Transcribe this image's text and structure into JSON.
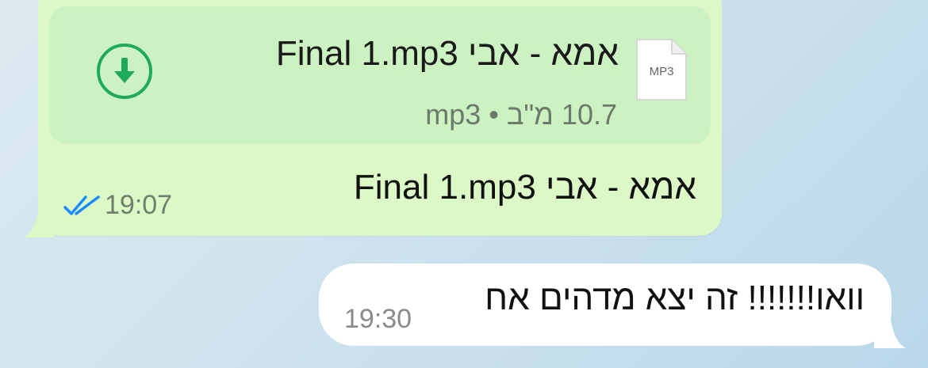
{
  "outgoing": {
    "file": {
      "name": "אמא - אבי  Final 1.mp3",
      "meta": "10.7 מ\"ב • mp3",
      "icon_label": "MP3",
      "icon": "download-icon"
    },
    "caption": "אמא - אבי  Final 1.mp3",
    "time": "19:07",
    "status_icon": "double-check-icon",
    "colors": {
      "bubble": "#dcf8c6",
      "card": "#cdf2c2",
      "accent": "#1faa59",
      "ticks": "#1a8cff"
    }
  },
  "incoming": {
    "text": "וואו!!!!!!! זה יצא מדהים אח",
    "time": "19:30",
    "colors": {
      "bubble": "#ffffff"
    }
  }
}
